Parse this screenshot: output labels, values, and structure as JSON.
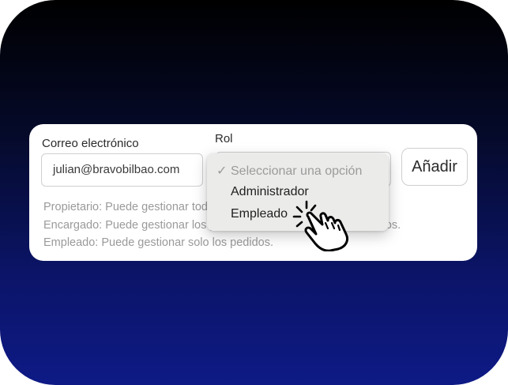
{
  "form": {
    "email_label": "Correo electrónico",
    "email_value": "julian@bravobilbao.com",
    "role_label": "Rol",
    "add_button_label": "Añadir"
  },
  "dropdown": {
    "placeholder": "Seleccionar una opción",
    "options": [
      "Administrador",
      "Empleado"
    ],
    "hovered": "Empleado"
  },
  "help": {
    "lines": [
      "Propietario: Puede gestionar todo.",
      "Encargado: Puede gestionar los pedidos, el catálogo y los empleados.",
      "Empleado: Puede gestionar solo los pedidos."
    ]
  },
  "icons": {
    "check": "check-icon",
    "cursor": "hand-pointer-icon"
  }
}
